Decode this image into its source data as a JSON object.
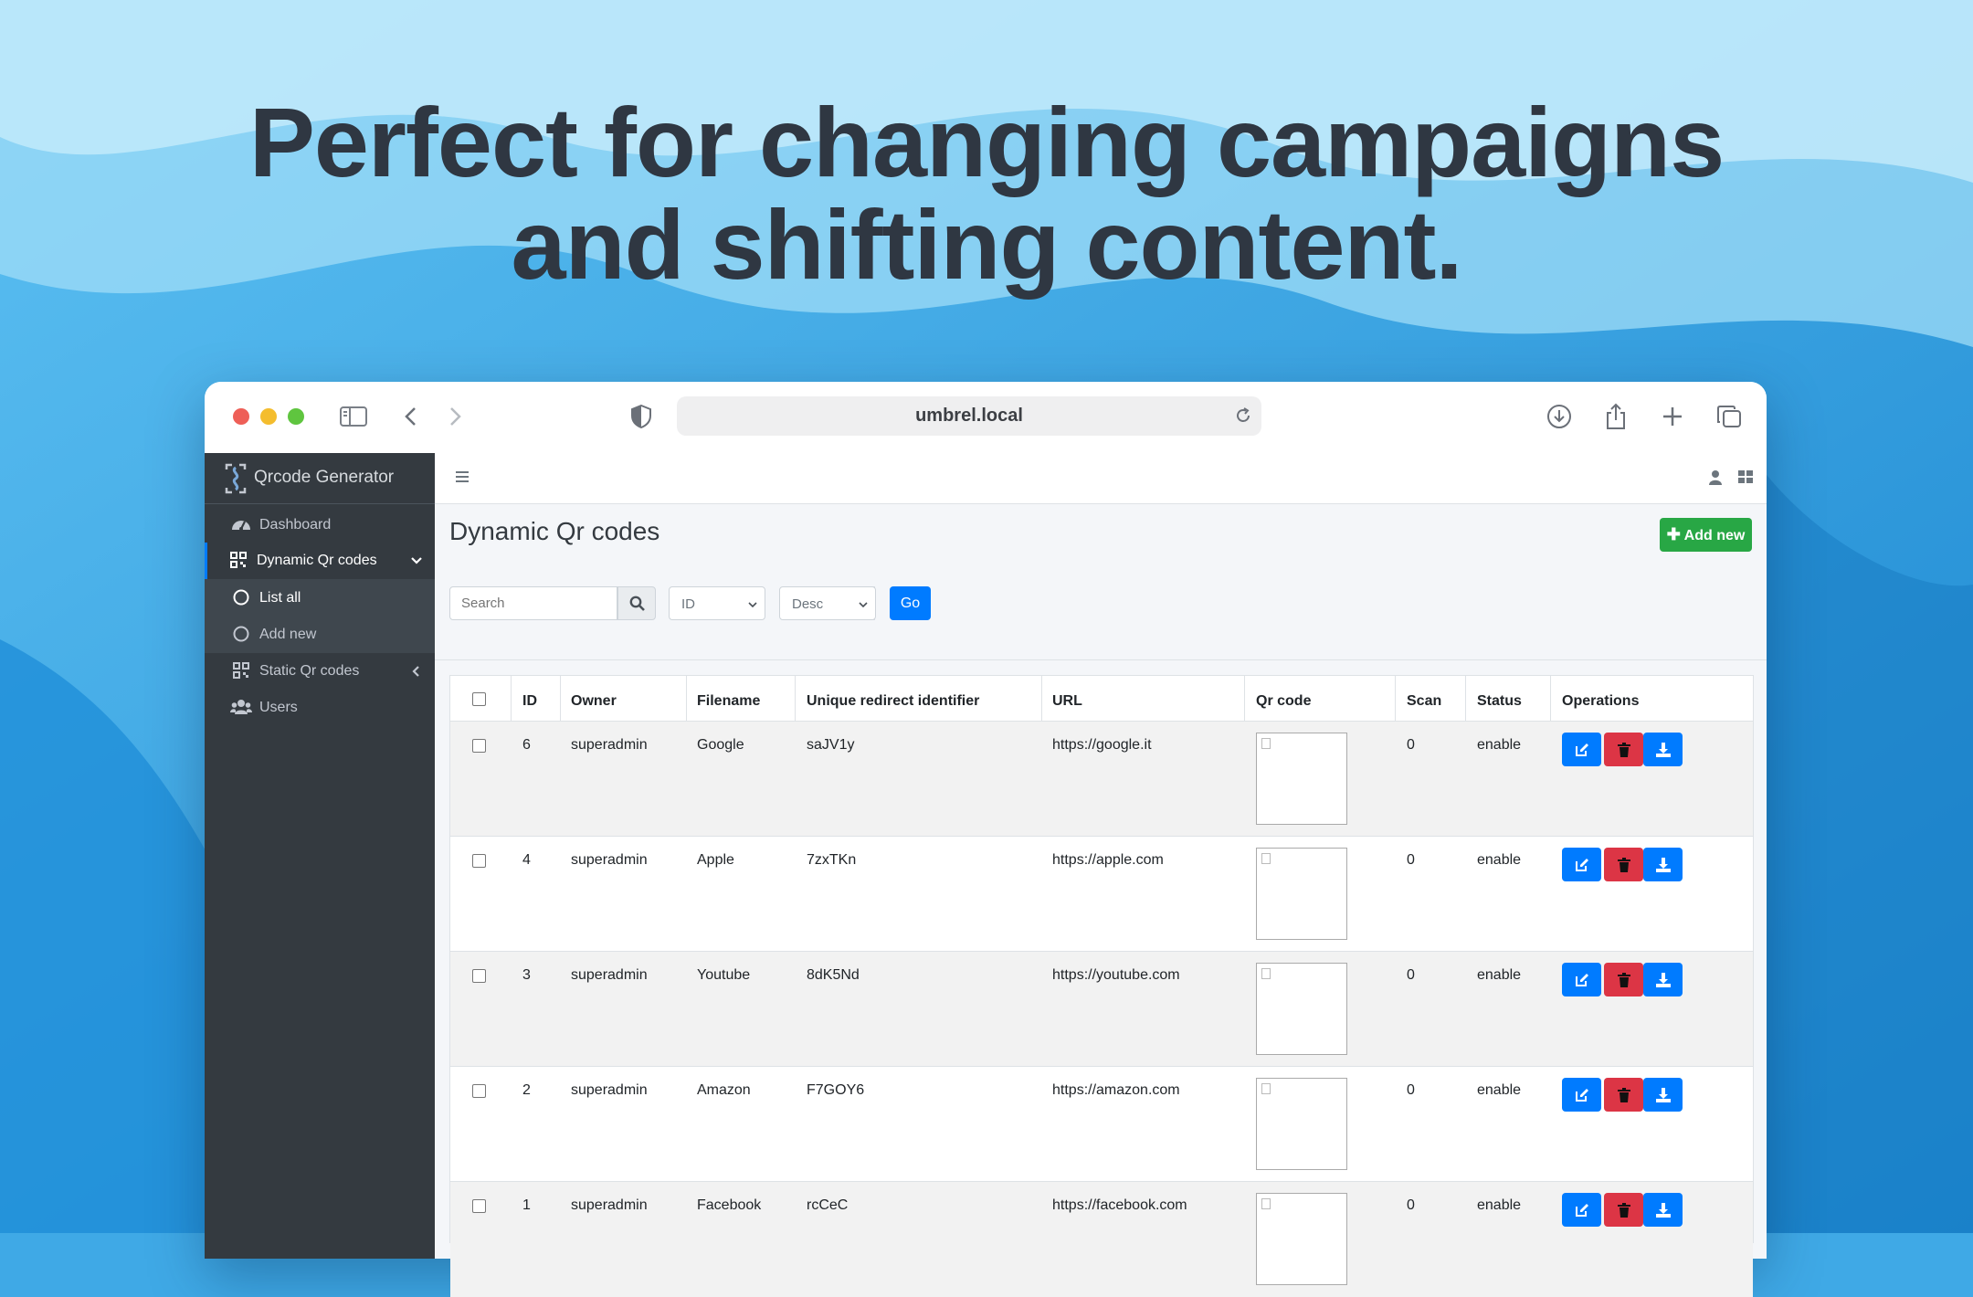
{
  "headline": {
    "line1": "Perfect for changing campaigns",
    "line2": "and shifting content."
  },
  "browser": {
    "address": "umbrel.local"
  },
  "sidebar": {
    "brand": "Qrcode Generator",
    "items": [
      {
        "label": "Dashboard",
        "icon": "tachometer-icon"
      },
      {
        "label": "Dynamic Qr codes",
        "icon": "qrcode-icon",
        "expanded": true
      },
      {
        "label": "List all",
        "icon": "circle-icon",
        "active": true
      },
      {
        "label": "Add new",
        "icon": "circle-icon"
      },
      {
        "label": "Static Qr codes",
        "icon": "qrcode-icon"
      },
      {
        "label": "Users",
        "icon": "users-icon"
      }
    ]
  },
  "page": {
    "title": "Dynamic Qr codes",
    "add_label": "Add new",
    "search_placeholder": "Search",
    "sort_field": "ID",
    "sort_order": "Desc",
    "go_label": "Go"
  },
  "table": {
    "headers": [
      "ID",
      "Owner",
      "Filename",
      "Unique redirect identifier",
      "URL",
      "Qr code",
      "Scan",
      "Status",
      "Operations"
    ],
    "rows": [
      {
        "id": "6",
        "owner": "superadmin",
        "filename": "Google",
        "identifier": "saJV1y",
        "url": "https://google.it",
        "scan": "0",
        "status": "enable"
      },
      {
        "id": "4",
        "owner": "superadmin",
        "filename": "Apple",
        "identifier": "7zxTKn",
        "url": "https://apple.com",
        "scan": "0",
        "status": "enable"
      },
      {
        "id": "3",
        "owner": "superadmin",
        "filename": "Youtube",
        "identifier": "8dK5Nd",
        "url": "https://youtube.com",
        "scan": "0",
        "status": "enable"
      },
      {
        "id": "2",
        "owner": "superadmin",
        "filename": "Amazon",
        "identifier": "F7GOY6",
        "url": "https://amazon.com",
        "scan": "0",
        "status": "enable"
      },
      {
        "id": "1",
        "owner": "superadmin",
        "filename": "Facebook",
        "identifier": "rcCeC",
        "url": "https://facebook.com",
        "scan": "0",
        "status": "enable"
      }
    ]
  },
  "colors": {
    "sidebar_bg": "#343a40",
    "primary": "#007bff",
    "success": "#28a745",
    "danger": "#dc3545"
  }
}
